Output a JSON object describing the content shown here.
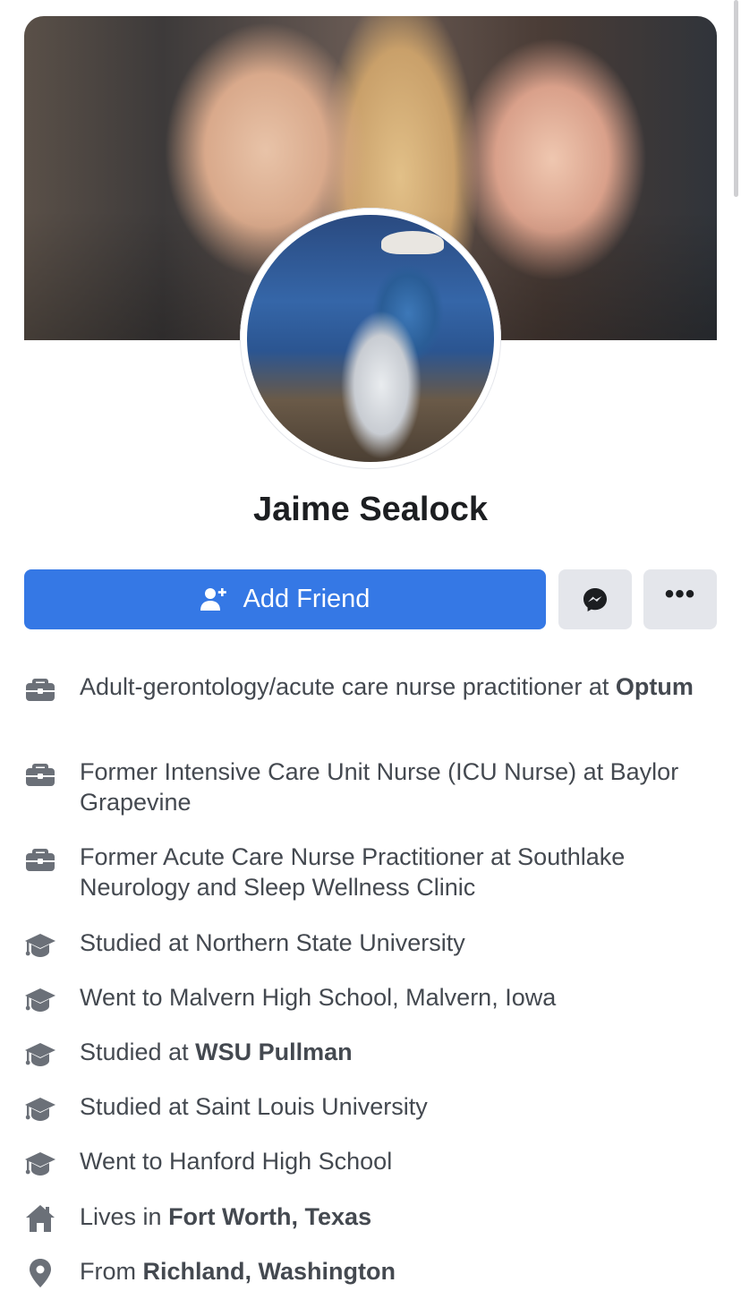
{
  "profile": {
    "name": "Jaime Sealock"
  },
  "actions": {
    "add_friend_label": "Add Friend",
    "add_friend_icon": "add-person-icon",
    "messenger_icon": "messenger-icon",
    "more_label": "•••"
  },
  "colors": {
    "primary": "#3578e5",
    "secondary_button": "#e4e6eb",
    "text": "#444950",
    "title": "#1c1e21",
    "icon": "#6b7078"
  },
  "info": [
    {
      "icon": "briefcase-icon",
      "prefix": "Adult-gerontology/acute care nurse practitioner at ",
      "bold": "Optum",
      "suffix": ""
    },
    {
      "icon": "briefcase-icon",
      "prefix": "Former Intensive Care Unit Nurse (ICU Nurse) at Baylor Grapevine",
      "bold": "",
      "suffix": ""
    },
    {
      "icon": "briefcase-icon",
      "prefix": "Former Acute Care Nurse Practitioner at Southlake Neurology and Sleep Wellness Clinic",
      "bold": "",
      "suffix": ""
    },
    {
      "icon": "graduation-cap-icon",
      "prefix": "Studied at Northern State University",
      "bold": "",
      "suffix": ""
    },
    {
      "icon": "graduation-cap-icon",
      "prefix": "Went to Malvern High School, Malvern, Iowa",
      "bold": "",
      "suffix": ""
    },
    {
      "icon": "graduation-cap-icon",
      "prefix": "Studied at ",
      "bold": "WSU Pullman",
      "suffix": ""
    },
    {
      "icon": "graduation-cap-icon",
      "prefix": "Studied at Saint Louis University",
      "bold": "",
      "suffix": ""
    },
    {
      "icon": "graduation-cap-icon",
      "prefix": "Went to Hanford High School",
      "bold": "",
      "suffix": ""
    },
    {
      "icon": "home-icon",
      "prefix": "Lives in ",
      "bold": "Fort Worth, Texas",
      "suffix": ""
    },
    {
      "icon": "location-pin-icon",
      "prefix": "From ",
      "bold": "Richland, Washington",
      "suffix": ""
    }
  ]
}
